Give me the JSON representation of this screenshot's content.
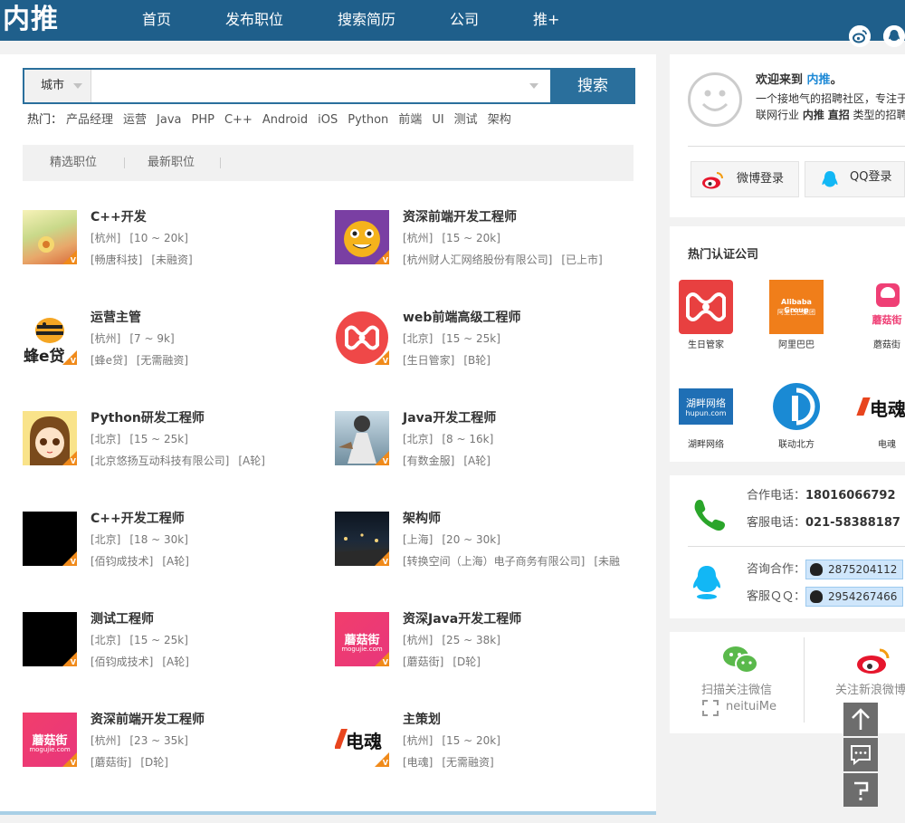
{
  "header": {
    "logo": "内推",
    "nav": [
      "首页",
      "发布职位",
      "搜索简历",
      "公司",
      "推+"
    ]
  },
  "search": {
    "city_label": "城市",
    "input_placeholder": "",
    "button_label": "搜索"
  },
  "hot": {
    "label": "热门：",
    "tags": [
      "产品经理",
      "运营",
      "Java",
      "PHP",
      "C++",
      "Android",
      "iOS",
      "Python",
      "前端",
      "UI",
      "测试",
      "架构"
    ]
  },
  "tabs": [
    "精选职位",
    "最新职位"
  ],
  "jobs": [
    {
      "title": "C++开发",
      "city": "[杭州]",
      "salary": "[10 ~ 20k]",
      "company": "[畅唐科技]",
      "stage": "[未融资]",
      "logo": "flower-photo-logo"
    },
    {
      "title": "资深前端开发工程师",
      "city": "[杭州]",
      "salary": "[15 ~ 20k]",
      "company": "[杭州财人汇网络股份有限公司]",
      "stage": "[已上市]",
      "logo": "cartoon-lion-logo"
    },
    {
      "title": "运营主管",
      "city": "[杭州]",
      "salary": "[7 ~ 9k]",
      "company": "[蜂e贷]",
      "stage": "[无需融资]",
      "logo": "bee-logo"
    },
    {
      "title": "web前端高级工程师",
      "city": "[北京]",
      "salary": "[15 ~ 25k]",
      "company": "[生日管家]",
      "stage": "[B轮]",
      "logo": "shengri-guanjia-logo"
    },
    {
      "title": "Python研发工程师",
      "city": "[北京]",
      "salary": "[15 ~ 25k]",
      "company": "[北京悠扬互动科技有限公司]",
      "stage": "[A轮]",
      "logo": "anime-girl-logo"
    },
    {
      "title": "Java开发工程师",
      "city": "[北京]",
      "salary": "[8 ~ 16k]",
      "company": "[有数金服]",
      "stage": "[A轮]",
      "logo": "illustration-logo"
    },
    {
      "title": "C++开发工程师",
      "city": "[北京]",
      "salary": "[18 ~ 30k]",
      "company": "[佰钧成技术]",
      "stage": "[A轮]",
      "logo": "black-logo"
    },
    {
      "title": "架构师",
      "city": "[上海]",
      "salary": "[20 ~ 30k]",
      "company": "[转换空间（上海）电子商务有限公司]",
      "stage": "[未融",
      "logo": "night-street-logo"
    },
    {
      "title": "测试工程师",
      "city": "[北京]",
      "salary": "[15 ~ 25k]",
      "company": "[佰钧成技术]",
      "stage": "[A轮]",
      "logo": "black-logo"
    },
    {
      "title": "资深Java开发工程师",
      "city": "[杭州]",
      "salary": "[25 ~ 38k]",
      "company": "[蘑菇街]",
      "stage": "[D轮]",
      "logo": "mogujie-logo"
    },
    {
      "title": "资深前端开发工程师",
      "city": "[杭州]",
      "salary": "[23 ~ 35k]",
      "company": "[蘑菇街]",
      "stage": "[D轮]",
      "logo": "mogujie-logo"
    },
    {
      "title": "主策划",
      "city": "[杭州]",
      "salary": "[15 ~ 20k]",
      "company": "[电魂]",
      "stage": "[无需融资]",
      "logo": "dianhun-logo"
    }
  ],
  "badge_text": "V",
  "mogujie_text": "蘑菇街",
  "mogujie_sub": "mogujie.com",
  "dianhun_text": "电魂",
  "welcome": {
    "line1_prefix": "欢迎来到",
    "line1_brand": "内推",
    "line1_suffix": "。",
    "line2": "一个接地气的招聘社区，专注于",
    "line3_prefix": "联网行业",
    "line3_b1": "内推",
    "line3_b2": "直招",
    "line3_suffix": "类型的招聘"
  },
  "login": {
    "weibo": "微博登录",
    "qq": "QQ登录"
  },
  "hot_companies": {
    "title": "热门认证公司",
    "items": [
      {
        "name": "生日管家"
      },
      {
        "name": "阿里巴巴"
      },
      {
        "name": "蘑菇街"
      },
      {
        "name": "湖畔网络"
      },
      {
        "name": "联动北方"
      },
      {
        "name": "电魂"
      }
    ],
    "hupan_text": "湖畔网络",
    "hupan_sub": "hupun.com",
    "alibaba_text": "Alibaba Group",
    "alibaba_sub": "阿里巴巴集团"
  },
  "contact": {
    "coop_phone_label": "合作电话：",
    "coop_phone": "18016066792",
    "service_phone_label": "客服电话：",
    "service_phone": "021-58388187",
    "coop_qq_label": "咨询合作：",
    "coop_qq": "2875204112",
    "service_qq_label": "客服ＱＱ：",
    "service_qq": "2954267466"
  },
  "follow": {
    "wechat_label": "扫描关注微信",
    "wechat_id": "neituiMe",
    "weibo_label": "关注新浪微博"
  },
  "colors": {
    "header": "#1f5f8b",
    "accent": "#2a6f9c",
    "badge": "#f08a1a",
    "link": "#1f8ad6"
  }
}
